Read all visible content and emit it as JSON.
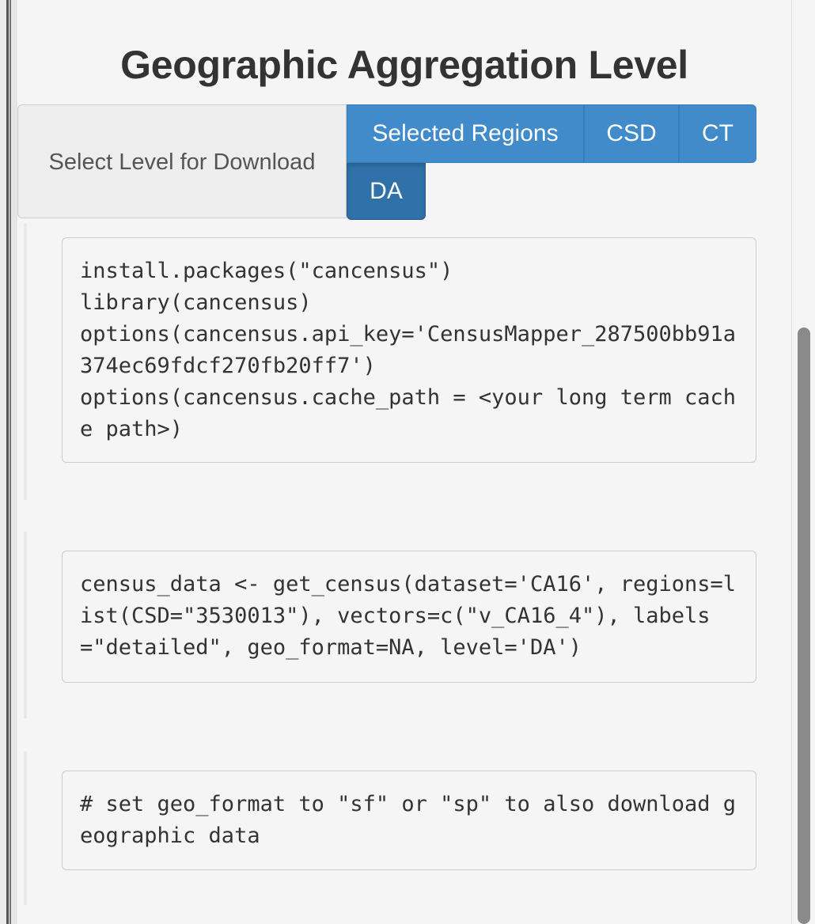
{
  "section": {
    "title": "Geographic Aggregation Level",
    "select_label": "Select Level for Download"
  },
  "levels": [
    {
      "label": "Selected Regions",
      "active": false
    },
    {
      "label": "CSD",
      "active": false
    },
    {
      "label": "CT",
      "active": false
    },
    {
      "label": "DA",
      "active": true
    }
  ],
  "code_blocks": [
    "install.packages(\"cancensus\")\nlibrary(cancensus)\noptions(cancensus.api_key='CensusMapper_287500bb91a374ec69fdcf270fb20ff7')\noptions(cancensus.cache_path = <your long term cache path>)",
    "census_data <- get_census(dataset='CA16', regions=list(CSD=\"3530013\"), vectors=c(\"v_CA16_4\"), labels=\"detailed\", geo_format=NA, level='DA')",
    "# set geo_format to \"sf\" or \"sp\" to also download geographic data"
  ],
  "colors": {
    "primary": "#428bca",
    "primary_active": "#3071a9",
    "background": "#f5f5f5"
  }
}
